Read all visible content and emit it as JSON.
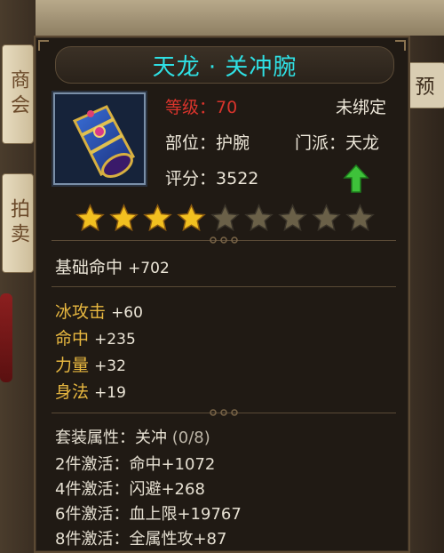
{
  "background": {
    "right_tab": "预",
    "side_buttons": [
      "商会",
      "拍卖"
    ]
  },
  "item": {
    "name": "天龙 · 关冲腕",
    "icon": "bracer-icon",
    "level_label": "等级：",
    "level_value": "70",
    "bind_status": "未绑定",
    "slot_label": "部位：",
    "slot_value": "护腕",
    "sect_label": "门派：",
    "sect_value": "天龙",
    "score_label": "评分：",
    "score_value": "3522",
    "upgrade_indicator": "green-up-arrow-icon",
    "stars_filled": 4,
    "stars_total": 9
  },
  "base_attr": {
    "label": "基础命中",
    "value": "+702"
  },
  "bonus_attrs": [
    {
      "label": "冰攻击",
      "value": "+60"
    },
    {
      "label": "命中",
      "value": "+235"
    },
    {
      "label": "力量",
      "value": "+32"
    },
    {
      "label": "身法",
      "value": "+19"
    }
  ],
  "set": {
    "header_label": "套装属性：",
    "header_name": "关冲",
    "header_count": "(0/8)",
    "bonuses": [
      {
        "label": "2件激活：",
        "value": "命中+1072"
      },
      {
        "label": "4件激活：",
        "value": "闪避+268"
      },
      {
        "label": "6件激活：",
        "value": "血上限+19767"
      },
      {
        "label": "8件激活：",
        "value": "全属性攻+87"
      }
    ]
  },
  "colors": {
    "title": "#2fe0e4",
    "level": "#d8342c",
    "bonus_attr": "#e8b840",
    "star_filled": "#f2c020",
    "star_empty": "#6a6048"
  }
}
